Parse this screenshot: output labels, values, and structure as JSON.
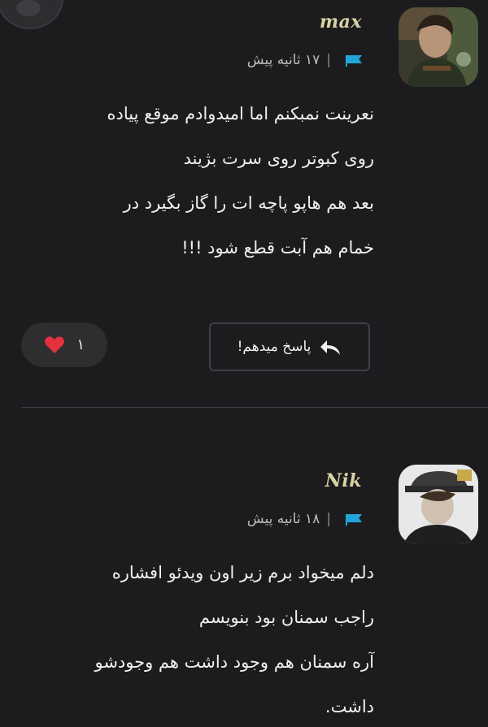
{
  "comments": [
    {
      "username": "max",
      "time": "۱۷ ثانیه پیش",
      "lines": [
        "نعرینت نمبکنم اما امیدوادم موقع پیاده",
        "روی کبوتر روی سرت بژیند",
        "بعد هم هاپو پاچه ات را گاز بگیرد در",
        "خمام هم آبت قطع شود !!!"
      ],
      "reply_label": "پاسخ میدهم!",
      "likes": "۱"
    },
    {
      "username": "Nik",
      "time": "۱۸ ثانیه پیش",
      "lines": [
        "دلم میخواد برم زیر اون ویدئو افشاره",
        "راجب سمنان بود بنویسم",
        "آره سمنان هم وجود داشت هم وجودشو",
        "داشت."
      ]
    }
  ],
  "colors": {
    "background": "#1c1c1e",
    "username": "#d8d3a6",
    "flag": "#22a6d8",
    "heart": "#e3323c"
  },
  "icons": {
    "flag": "flag-icon",
    "reply": "reply-arrow-icon",
    "like": "heart-icon"
  }
}
